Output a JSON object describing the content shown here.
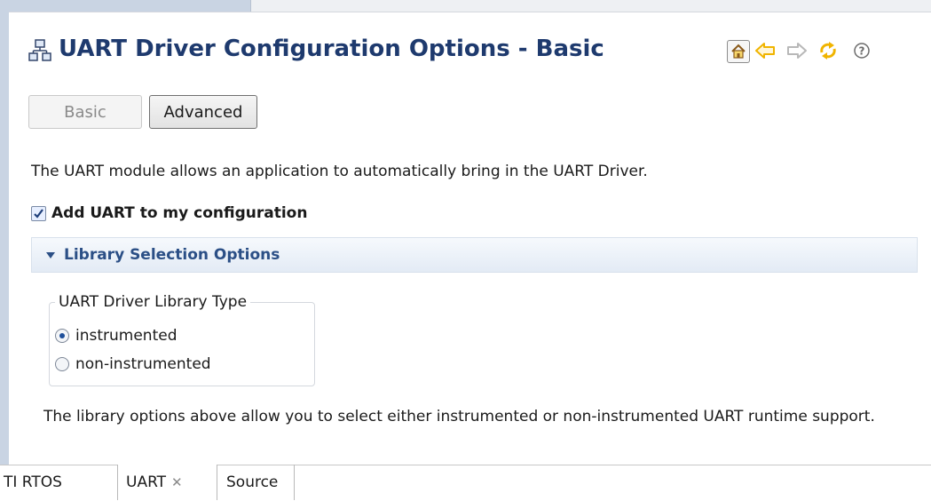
{
  "header": {
    "title": "UART Driver Configuration Options - Basic",
    "title_icon": "module-config-icon",
    "toolbar": [
      {
        "icon": "home-icon"
      },
      {
        "icon": "back-arrow-icon"
      },
      {
        "icon": "forward-arrow-icon"
      },
      {
        "icon": "refresh-icon"
      },
      {
        "icon": "help-icon"
      }
    ]
  },
  "mode_tabs": {
    "basic_label": "Basic",
    "advanced_label": "Advanced"
  },
  "description": "The UART module allows an application to automatically bring in the UART Driver.",
  "add_checkbox": {
    "label": "Add UART to my configuration",
    "checked": true
  },
  "section": {
    "label": "Library Selection Options",
    "expanded": true
  },
  "library_type": {
    "title": "UART Driver Library Type",
    "options": [
      "instrumented",
      "non-instrumented"
    ],
    "selected": "instrumented"
  },
  "note": "The library options above allow you to select either instrumented or non-instrumented UART runtime support.",
  "editor_tabs": {
    "tirtos_label": "TI RTOS",
    "uart_label": "UART",
    "uart_close": "✕",
    "source_label": "Source"
  },
  "colors": {
    "title": "#1e3a6e",
    "section_label": "#2b4f86",
    "arrow_icons": "#f0b400",
    "disabled_text": "#8a8a8a"
  }
}
